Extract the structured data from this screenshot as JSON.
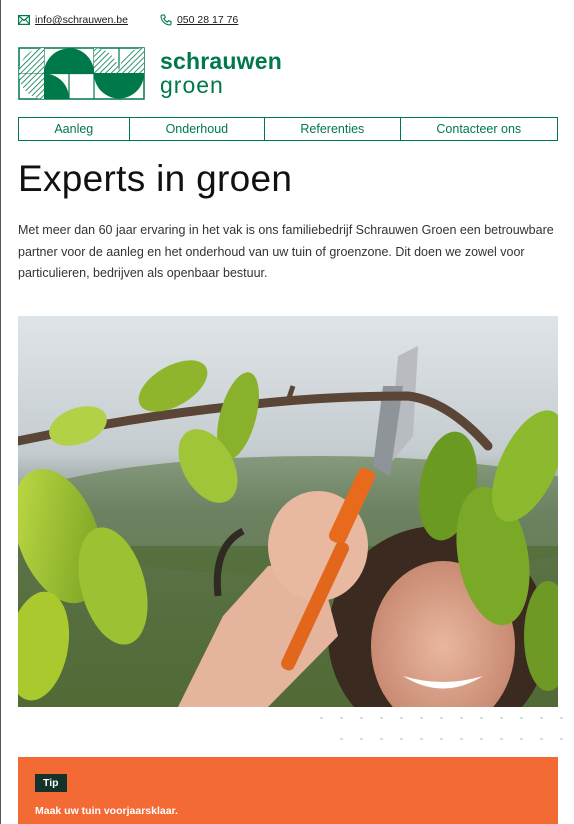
{
  "contact": {
    "email": "info@schrauwen.be",
    "phone": "050 28 17 76"
  },
  "logo": {
    "line1": "schrauwen",
    "line2": "groen"
  },
  "nav": {
    "items": [
      "Aanleg",
      "Onderhoud",
      "Referenties",
      "Contacteer ons"
    ]
  },
  "hero": {
    "title": "Experts in groen",
    "intro": "Met meer dan 60 jaar ervaring in het vak is ons familiebedrijf Schrauwen Groen een betrouwbare partner voor de aanleg en het onderhoud van uw tuin of groenzone. Dit doen we zowel voor particulieren, bedrijven als openbaar bestuur."
  },
  "tip": {
    "badge": "Tip",
    "text": "Maak uw tuin voorjaarsklaar."
  },
  "colors": {
    "brand_green": "#00794a",
    "accent_orange": "#f46a35",
    "badge_dark": "#12322a"
  }
}
